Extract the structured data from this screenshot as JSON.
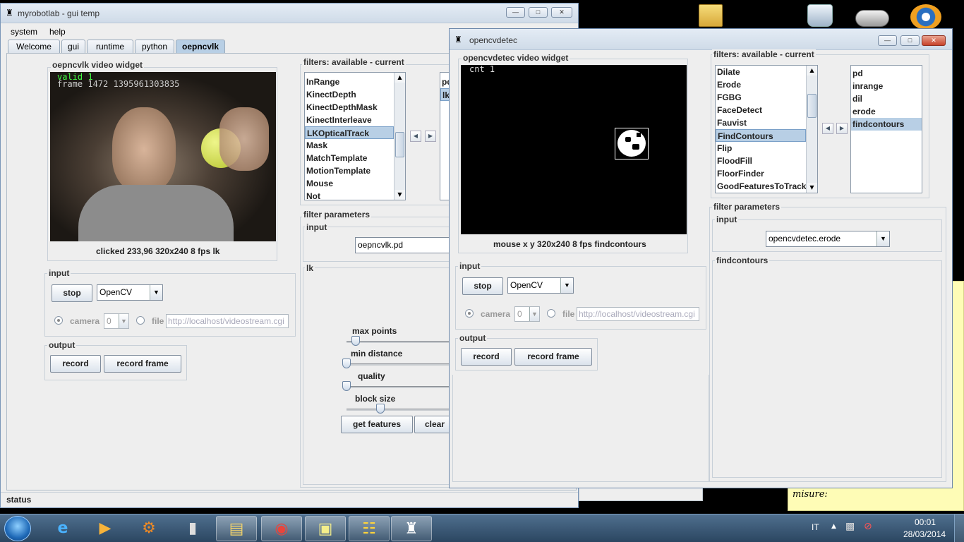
{
  "colors": {
    "accent": "#b8cfe5",
    "desktop": "#000000",
    "sticky_note": "#fefcb6"
  },
  "main_window": {
    "title": "myrobotlab - gui temp",
    "menu": [
      "system",
      "help"
    ],
    "tabs": [
      "Welcome",
      "gui",
      "runtime",
      "python",
      "oepncvlk"
    ],
    "video_panel": {
      "title": "oepncvlk  video widget",
      "overlay_line1": "valid 1",
      "overlay_line2": "frame 1472 1395961303835",
      "status": "clicked 233,96  320x240  8 fps  lk"
    },
    "input": {
      "title": "input",
      "stop": "stop",
      "source": "OpenCV",
      "camera_label": "camera",
      "camera_index": "0",
      "file_label": "file",
      "file_url": "http://localhost/videostream.cgi"
    },
    "output": {
      "title": "output",
      "record": "record",
      "record_frame": "record frame"
    },
    "filters": {
      "title": "filters: available - current",
      "available": [
        "InRange",
        "KinectDepth",
        "KinectDepthMask",
        "KinectInterleave",
        "LKOpticalTrack",
        "Mask",
        "MatchTemplate",
        "MotionTemplate",
        "Mouse",
        "Not"
      ],
      "selected": "LKOpticalTrack",
      "current": [
        "pd",
        "lk"
      ]
    },
    "filter_params": {
      "title": "filter parameters",
      "input_title": "input",
      "input_value": "oepncvlk.pd",
      "lk_title": "lk",
      "max_points": "max points",
      "min_distance": "min distance",
      "quality": "quality",
      "block_size": "block size",
      "max_points_level": 0.08,
      "min_distance_level": 0.0,
      "quality_level": 0.0,
      "block_size_level": 0.3,
      "get_features": "get features",
      "clear": "clear"
    },
    "status": "status"
  },
  "cv_window": {
    "title": "opencvdetec",
    "video_panel": {
      "title": "opencvdetec  video widget",
      "overlay": "cnt 1",
      "status": "mouse x y  320x240  8 fps  findcontours"
    },
    "input": {
      "title": "input",
      "stop": "stop",
      "source": "OpenCV",
      "camera_label": "camera",
      "camera_index": "0",
      "file_label": "file",
      "file_url": "http://localhost/videostream.cgi"
    },
    "output": {
      "title": "output",
      "record": "record",
      "record_frame": "record frame"
    },
    "filters": {
      "title": "filters: available - current",
      "available": [
        "Dilate",
        "Erode",
        "FGBG",
        "FaceDetect",
        "Fauvist",
        "FindContours",
        "Flip",
        "FloodFill",
        "FloorFinder",
        "GoodFeaturesToTrack"
      ],
      "selected": "FindContours",
      "current": [
        "pd",
        "inrange",
        "dil",
        "erode",
        "findcontours"
      ],
      "current_selected": "findcontours"
    },
    "filter_params": {
      "title": "filter parameters",
      "input_title": "input",
      "input_value": "opencvdetec.erode",
      "findcontours_title": "findcontours"
    }
  },
  "sticky": {
    "text": "misure:"
  },
  "taskbar": {
    "lang": "IT",
    "time": "00:01",
    "date": "28/03/2014"
  }
}
